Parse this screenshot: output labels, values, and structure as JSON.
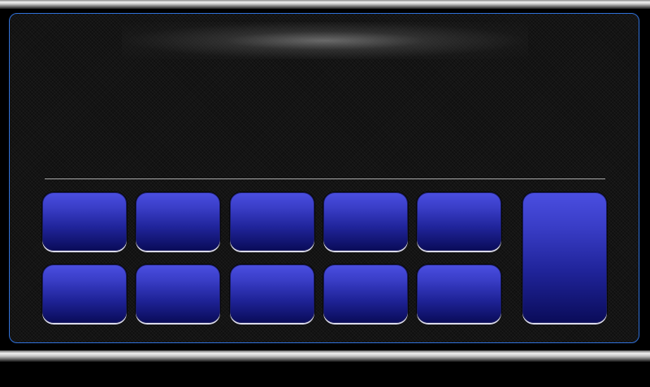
{
  "screen": {
    "display": {
      "text": ""
    }
  },
  "keypad": {
    "rows": [
      [
        {
          "label": ""
        },
        {
          "label": ""
        },
        {
          "label": ""
        },
        {
          "label": ""
        },
        {
          "label": ""
        }
      ],
      [
        {
          "label": ""
        },
        {
          "label": ""
        },
        {
          "label": ""
        },
        {
          "label": ""
        },
        {
          "label": ""
        }
      ]
    ],
    "side_key": {
      "label": ""
    }
  },
  "colors": {
    "key_top": "#4a4ee0",
    "key_bottom": "#0a0c5a",
    "panel_border": "#2f6fd6",
    "background": "#000000"
  }
}
